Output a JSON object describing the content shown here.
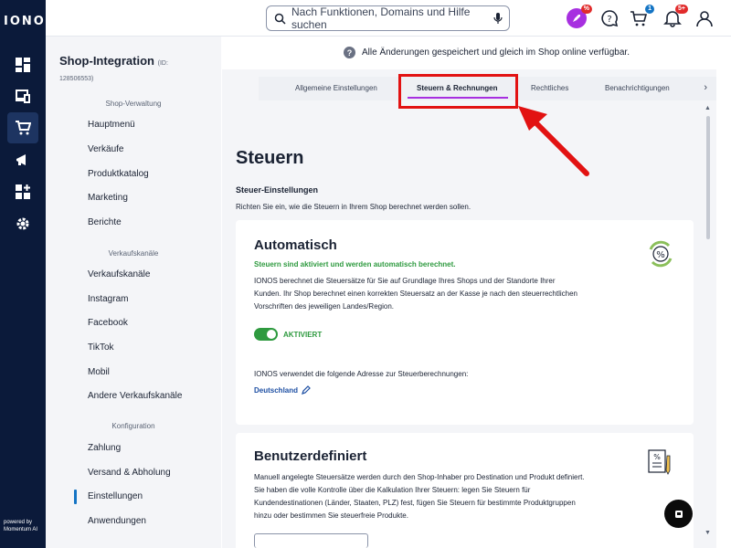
{
  "app": {
    "brand": "IONOS",
    "powered_by": "powered by",
    "powered_name": "Momentum AI"
  },
  "topbar": {
    "search_placeholder": "Nach Funktionen, Domains und Hilfe suchen",
    "rocket_badge": "%",
    "cart_badge": "1",
    "bell_badge": "5+"
  },
  "sidebar": {
    "title": "Shop-Integration",
    "title_suffix": "(ID:",
    "id": "128506553)",
    "sections": [
      {
        "label": "Shop-Verwaltung",
        "items": [
          "Hauptmenü",
          "Verkäufe",
          "Produktkatalog",
          "Marketing",
          "Berichte"
        ]
      },
      {
        "label": "Verkaufskanäle",
        "items": [
          "Verkaufskanäle",
          "Instagram",
          "Facebook",
          "TikTok",
          "Mobil",
          "Andere Verkaufskanäle"
        ]
      },
      {
        "label": "Konfiguration",
        "items": [
          "Zahlung",
          "Versand & Abholung",
          "Einstellungen",
          "Anwendungen"
        ]
      }
    ],
    "active_item": "Einstellungen"
  },
  "info_bar": {
    "text": "Alle Änderungen gespeichert und gleich im Shop online verfügbar."
  },
  "tabs": [
    {
      "label": "Allgemeine Einstellungen",
      "active": false
    },
    {
      "label": "Steuern & Rechnungen",
      "active": true
    },
    {
      "label": "Rechtliches",
      "active": false
    },
    {
      "label": "Benachrichtigungen",
      "active": false
    }
  ],
  "main": {
    "heading": "Steuern",
    "subheading": "Steuer-Einstellungen",
    "description": "Richten Sie ein, wie die Steuern in Ihrem Shop berechnet werden sollen."
  },
  "card_auto": {
    "title": "Automatisch",
    "status": "Steuern sind aktiviert und werden automatisch berechnet.",
    "body": "IONOS berechnet die Steuersätze für Sie auf Grundlage Ihres Shops und der Standorte Ihrer Kunden. Ihr Shop berechnet einen korrekten Steuersatz an der Kasse je nach den steuerrechtlichen Vorschriften des jeweiligen Landes/Region.",
    "toggle_label": "AKTIVIERT",
    "address_text": "IONOS verwendet die folgende Adresse zur Steuerberechnungen:",
    "address_link": "Deutschland"
  },
  "card_custom": {
    "title": "Benutzerdefiniert",
    "body": "Manuell angelegte Steuersätze werden durch den Shop-Inhaber pro Destination und Produkt definiert. Sie haben die volle Kontrolle über die Kalkulation Ihrer Steuern: legen Sie Steuern für Kundendestinationen (Länder, Staaten, PLZ) fest, fügen Sie Steuern für bestimmte Produktgruppen hinzu oder bestimmen Sie steuerfreie Produkte."
  },
  "colors": {
    "rail": "#0b1a3a",
    "accent": "#a72fe0",
    "success": "#2e9a3f",
    "link": "#1d4fa3",
    "annotation": "#e21212"
  }
}
